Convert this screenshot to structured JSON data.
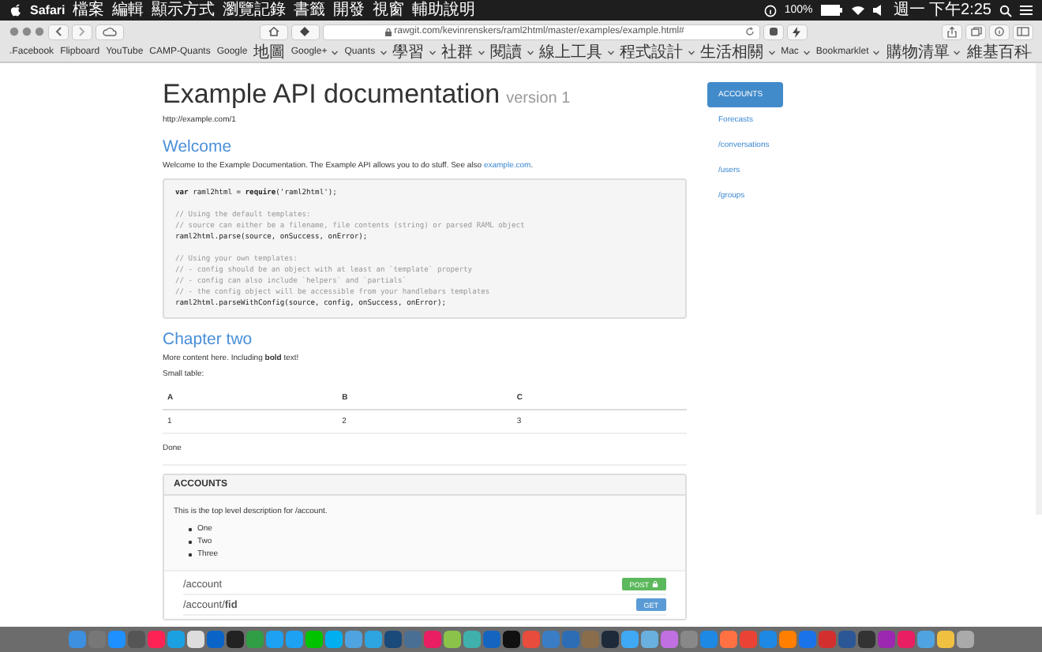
{
  "menu_bar": {
    "app": "Safari",
    "items": [
      "檔案",
      "編輯",
      "顯示方式",
      "瀏覽記錄",
      "書籤",
      "開發",
      "視窗",
      "輔助說明"
    ],
    "battery": "100%",
    "clock": "週一 下午2:25"
  },
  "toolbar": {
    "url": "rawgit.com/kevinrenskers/raml2html/master/examples/example.html#"
  },
  "bookmarks": [
    {
      "label": "Facebook",
      "folder": false
    },
    {
      "label": "Flipboard",
      "folder": false
    },
    {
      "label": "YouTube",
      "folder": false
    },
    {
      "label": "CAMP-Quants",
      "folder": false
    },
    {
      "label": "Google 地圖",
      "folder": false
    },
    {
      "label": "Google+",
      "folder": true
    },
    {
      "label": "Quants",
      "folder": true
    },
    {
      "label": "學習",
      "folder": true
    },
    {
      "label": "社群",
      "folder": true
    },
    {
      "label": "閱讀",
      "folder": true
    },
    {
      "label": "線上工具",
      "folder": true
    },
    {
      "label": "程式設計",
      "folder": true
    },
    {
      "label": "生活相關",
      "folder": true
    },
    {
      "label": "Mac",
      "folder": true
    },
    {
      "label": "Bookmarklet",
      "folder": true
    },
    {
      "label": "購物清單",
      "folder": true
    },
    {
      "label": "維基百科",
      "folder": false
    }
  ],
  "page": {
    "title": "Example API documentation",
    "version": "version 1",
    "base_uri": "http://example.com/1",
    "welcome": {
      "heading": "Welcome",
      "text": "Welcome to the Example Documentation. The Example API allows you to do stuff. See also ",
      "link": "example.com",
      "after": "."
    },
    "code": [
      {
        "kind": "code",
        "text": "**var** raml2html = **require**('raml2html');"
      },
      {
        "kind": "blank"
      },
      {
        "kind": "comment",
        "text": "// Using the default templates:"
      },
      {
        "kind": "comment",
        "text": "// source can either be a filename, file contents (string) or parsed RAML object"
      },
      {
        "kind": "code",
        "text": "raml2html.parse(source, onSuccess, onError);"
      },
      {
        "kind": "blank"
      },
      {
        "kind": "comment",
        "text": "// Using your own templates:"
      },
      {
        "kind": "comment",
        "text": "// - config should be an object with at least an `template` property"
      },
      {
        "kind": "comment",
        "text": "// - config can also include `helpers` and `partials`"
      },
      {
        "kind": "comment",
        "text": "// - the config object will be accessible from your handlebars templates"
      },
      {
        "kind": "code",
        "text": "raml2html.parseWithConfig(source, config, onSuccess, onError);"
      }
    ],
    "chapter": {
      "heading": "Chapter two",
      "text": "More content here. Including **bold** text!",
      "table_caption": "Small table:",
      "table": {
        "columns": [
          "A",
          "B",
          "C"
        ],
        "rows": [
          [
            "1",
            "2",
            "3"
          ]
        ]
      },
      "done": "Done"
    },
    "panel": {
      "title": "ACCOUNTS",
      "description": "This is the top level description for /account.",
      "list": [
        "One",
        "Two",
        "Three"
      ],
      "resources": [
        {
          "path": "/account",
          "method": "POST",
          "locked": true
        },
        {
          "path": "/account/**fid**",
          "method": "GET",
          "locked": false
        }
      ]
    }
  },
  "sidebar": [
    {
      "label": "ACCOUNTS",
      "selected": true
    },
    {
      "label": "Forecasts",
      "selected": false
    },
    {
      "label": "/conversations",
      "selected": false
    },
    {
      "label": "/users",
      "selected": false
    },
    {
      "label": "/groups",
      "selected": false
    }
  ]
}
